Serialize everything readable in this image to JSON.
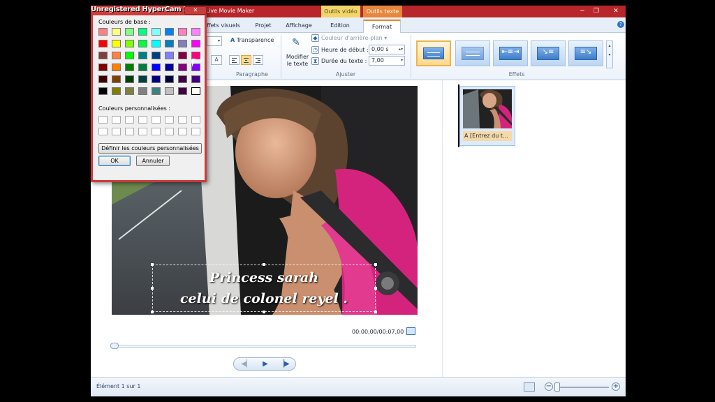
{
  "window": {
    "title": "s Live Movie Maker",
    "controls": {
      "minimize": "−",
      "maximize": "❐",
      "close": "✕"
    },
    "context_tabs": [
      "Outils vidéo",
      "Outils texte"
    ]
  },
  "ribbon_tabs": [
    "ffets visuels",
    "Projet",
    "Affichage",
    "Edition",
    "Format"
  ],
  "ribbon": {
    "font": {
      "transparency_label": "Transparence"
    },
    "paragraph": {
      "label": "Paragraphe"
    },
    "edit_text": {
      "label_line1": "Modifier",
      "label_line2": "le texte"
    },
    "adjust": {
      "label": "Ajuster",
      "background_color": "Couleur d'arrière-plan",
      "start_time_label": "Heure de début :",
      "start_time_value": "0,00 s",
      "duration_label": "Durée du texte :",
      "duration_value": "7,00"
    },
    "effects": {
      "label": "Effets"
    }
  },
  "preview": {
    "caption_line1": "Princess sarah",
    "caption_line2": "celui de colonel reyel .",
    "timecode": "00:00,00/00:07,00",
    "buttons": {
      "previous": "◀▏",
      "play": "▶",
      "next": "▕▶"
    }
  },
  "storyboard": {
    "clip_label": "A [Entrez du t..."
  },
  "status": {
    "item_text": "Élément 1 sur 1",
    "zoom_out": "−",
    "zoom_in": "+"
  },
  "overlay": {
    "watermark": "Unregistered HyperCam 2"
  },
  "color_dialog": {
    "close_label": "✕",
    "basic_colors_label": "Couleurs de base :",
    "custom_colors_label": "Couleurs personnalisées :",
    "define_button": "Définir les couleurs personnalisées >>",
    "ok_button": "OK",
    "cancel_button": "Annuler",
    "basic_colors": [
      "#ff8080",
      "#ffff80",
      "#80ff80",
      "#00ff80",
      "#80ffff",
      "#0080ff",
      "#ff80c0",
      "#ff80ff",
      "#ff0000",
      "#ffff00",
      "#80ff00",
      "#00ff40",
      "#00ffff",
      "#0080c0",
      "#8080c0",
      "#ff00ff",
      "#804040",
      "#ff8040",
      "#00ff00",
      "#008080",
      "#004080",
      "#8080ff",
      "#800040",
      "#ff0080",
      "#800000",
      "#ff8000",
      "#008000",
      "#008040",
      "#0000ff",
      "#0000a0",
      "#800080",
      "#8000ff",
      "#400000",
      "#804000",
      "#004000",
      "#004040",
      "#000080",
      "#000040",
      "#400040",
      "#400080",
      "#000000",
      "#808000",
      "#808040",
      "#808080",
      "#408080",
      "#c0c0c0",
      "#400040",
      "#ffffff"
    ]
  },
  "colors": {
    "title_bar": "#b8252a",
    "context_video": "#f2d66b",
    "context_text": "#e8863a",
    "dialog_border": "#cf3a3a",
    "caption_text": "#ffffff"
  }
}
